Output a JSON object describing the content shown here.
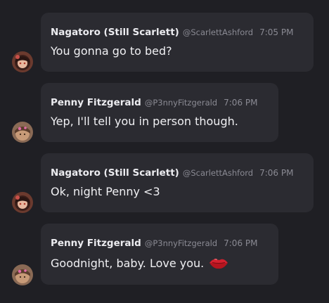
{
  "messages": [
    {
      "author": "Nagatoro (Still Scarlett)",
      "handle": "@ScarlettAshford",
      "time": "7:05 PM",
      "text": "You gonna go to bed?",
      "avatar": "scarlett-avatar"
    },
    {
      "author": "Penny Fitzgerald",
      "handle": "@P3nnyFitzgerald",
      "time": "7:06 PM",
      "text": "Yep, I'll tell you in person though.",
      "avatar": "penny-avatar"
    },
    {
      "author": "Nagatoro (Still Scarlett)",
      "handle": "@ScarlettAshford",
      "time": "7:06 PM",
      "text": "Ok, night Penny <3",
      "avatar": "scarlett-avatar"
    },
    {
      "author": "Penny Fitzgerald",
      "handle": "@P3nnyFitzgerald",
      "time": "7:06 PM",
      "text": "Goodnight, baby. Love you.",
      "avatar": "penny-avatar",
      "emoji": "kiss-mark-icon"
    }
  ],
  "colors": {
    "background": "#1f1f24",
    "bubble": "#2b2b31",
    "author": "#ececf0",
    "meta": "#8a8a93",
    "text": "#f0f0f3",
    "kiss": "#d4202e"
  }
}
